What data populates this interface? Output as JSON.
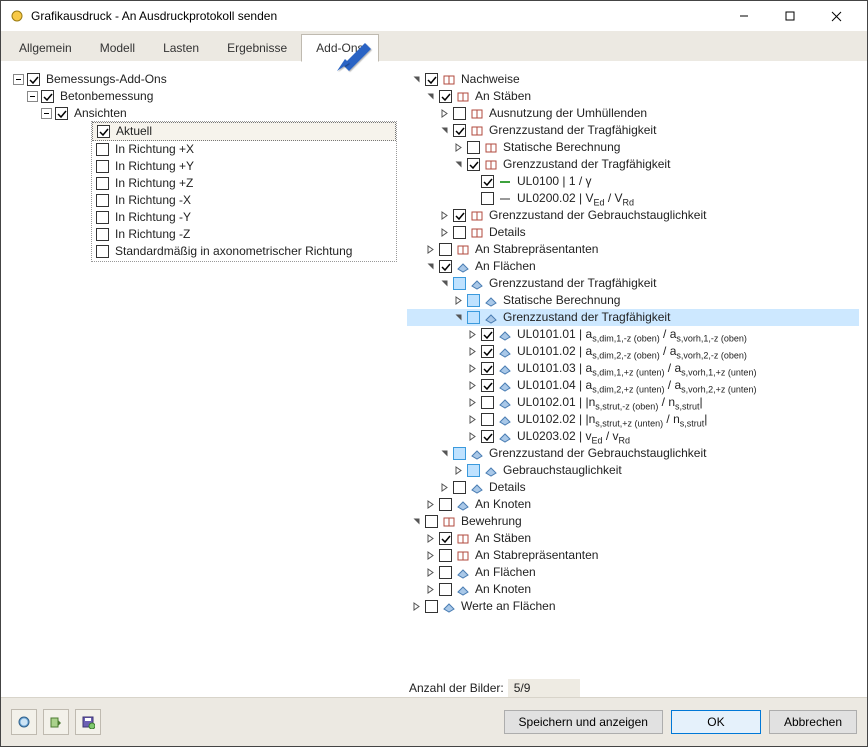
{
  "window": {
    "title": "Grafikausdruck - An Ausdruckprotokoll senden"
  },
  "tabs": [
    "Allgemein",
    "Modell",
    "Lasten",
    "Ergebnisse",
    "Add-Ons"
  ],
  "active_tab": "Add-Ons",
  "left_tree": {
    "root": "Bemessungs-Add-Ons",
    "child": "Betonbemessung",
    "views": "Ansichten",
    "current": "Aktuell",
    "items": [
      "In Richtung +X",
      "In Richtung +Y",
      "In Richtung +Z",
      "In Richtung -X",
      "In Richtung -Y",
      "In Richtung -Z",
      "Standardmäßig in axonometrischer Richtung"
    ]
  },
  "right_tree": {
    "nachweise": "Nachweise",
    "staben": "An Stäben",
    "ausnutz": "Ausnutzung der Umhüllenden",
    "gzt": "Grenzzustand der Tragfähigkeit",
    "statik": "Statische Berechnung",
    "ul0100": {
      "code": "UL0100",
      "desc": "1 / γ"
    },
    "ul0200": {
      "code": "UL0200.02",
      "desc": "V<sub>Ed</sub> / V<sub>Rd</sub>"
    },
    "gzg": "Grenzzustand der Gebrauchstauglichkeit",
    "details": "Details",
    "stabrep": "An Stabrepräsentanten",
    "flaechen": "An Flächen",
    "ul_items": [
      {
        "code": "UL0101.01",
        "desc": "a<sub>s,dim,1,-z (oben)</sub> / a<sub>s,vorh,1,-z (oben)</sub>"
      },
      {
        "code": "UL0101.02",
        "desc": "a<sub>s,dim,2,-z (oben)</sub> / a<sub>s,vorh,2,-z (oben)</sub>"
      },
      {
        "code": "UL0101.03",
        "desc": "a<sub>s,dim,1,+z (unten)</sub> / a<sub>s,vorh,1,+z (unten)</sub>"
      },
      {
        "code": "UL0101.04",
        "desc": "a<sub>s,dim,2,+z (unten)</sub> / a<sub>s,vorh,2,+z (unten)</sub>"
      },
      {
        "code": "UL0102.01",
        "desc": "|n<sub>s,strut,-z (oben)</sub> / n<sub>s,strut</sub>|"
      },
      {
        "code": "UL0102.02",
        "desc": "|n<sub>s,strut,+z (unten)</sub> / n<sub>s,strut</sub>|"
      },
      {
        "code": "UL0203.02",
        "desc": "v<sub>Ed</sub> / v<sub>Rd</sub>"
      }
    ],
    "gebr": "Gebrauchstauglichkeit",
    "knoten": "An Knoten",
    "bewehrung": "Bewehrung",
    "werte": "Werte an Flächen"
  },
  "footer": {
    "img_count_label": "Anzahl der Bilder:",
    "img_count_val": "5/9",
    "save_show": "Speichern und anzeigen",
    "ok": "OK",
    "cancel": "Abbrechen"
  }
}
